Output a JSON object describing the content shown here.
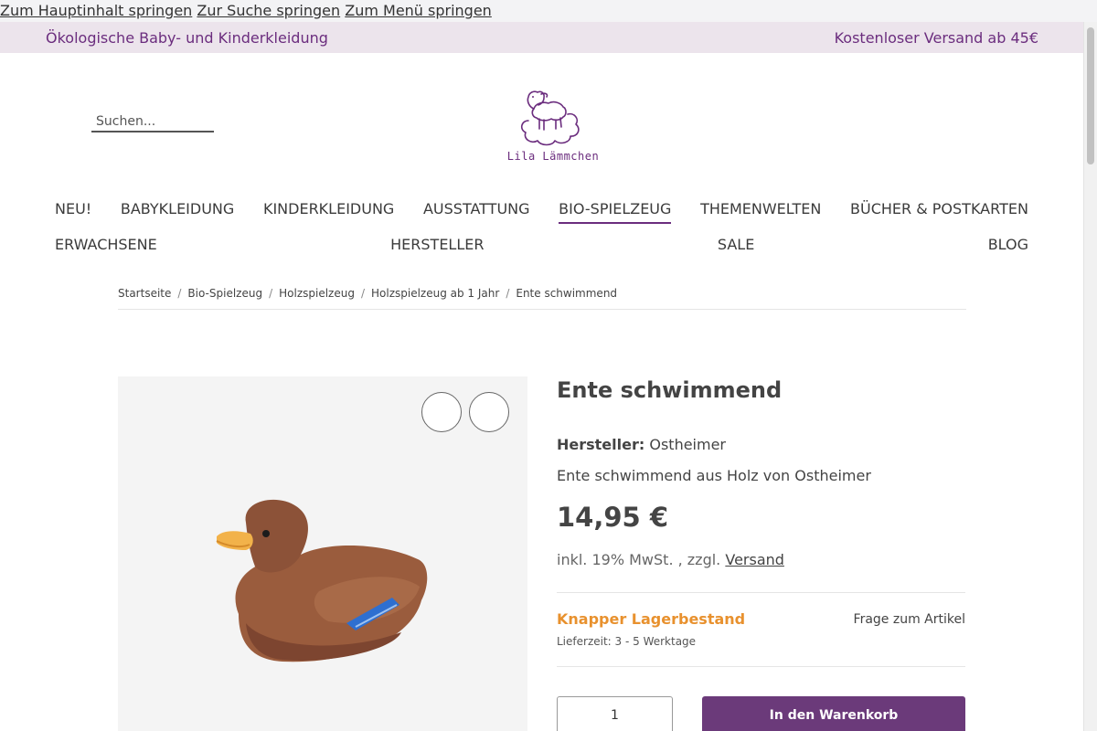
{
  "skip_links": [
    "Zum Hauptinhalt springen",
    "Zur Suche springen",
    "Zum Menü springen"
  ],
  "topbar": {
    "left": "Ökologische Baby- und Kinderkleidung",
    "right": "Kostenloser Versand ab 45€"
  },
  "search": {
    "placeholder": "Suchen..."
  },
  "logo": {
    "text": "Lila Lämmchen"
  },
  "nav": {
    "row1": [
      "NEU!",
      "BABYKLEIDUNG",
      "KINDERKLEIDUNG",
      "AUSSTATTUNG",
      "BIO-SPIELZEUG",
      "THEMENWELTEN",
      "BÜCHER & POSTKARTEN"
    ],
    "row2": [
      "ERWACHSENE",
      "HERSTELLER",
      "SALE",
      "BLOG"
    ],
    "active": "BIO-SPIELZEUG"
  },
  "breadcrumb": [
    "Startseite",
    "Bio-Spielzeug",
    "Holzspielzeug",
    "Holzspielzeug ab 1 Jahr",
    "Ente schwimmend"
  ],
  "breadcrumb_separator": "/",
  "product": {
    "title": "Ente schwimmend",
    "manufacturer_label": "Hersteller:",
    "manufacturer": "Ostheimer",
    "description": "Ente schwimmend aus Holz von Ostheimer",
    "price": "14,95 €",
    "tax_text": "inkl. 19% MwSt. , zzgl.",
    "shipping_link": "Versand",
    "stock_status": "Knapper Lagerbestand",
    "delivery_time": "Lieferzeit: 3 - 5 Werktage",
    "question_link": "Frage zum Artikel",
    "quantity": "1",
    "add_to_cart": "In den Warenkorb"
  },
  "colors": {
    "brand": "#6b2d7e",
    "topbar_bg": "#ece4ec",
    "stock_warning": "#e8912e",
    "cart_button": "#6b3a7a"
  },
  "icons": [
    "logo-lamb-cloud-icon",
    "gallery-circle-icon",
    "duck-product-image"
  ]
}
